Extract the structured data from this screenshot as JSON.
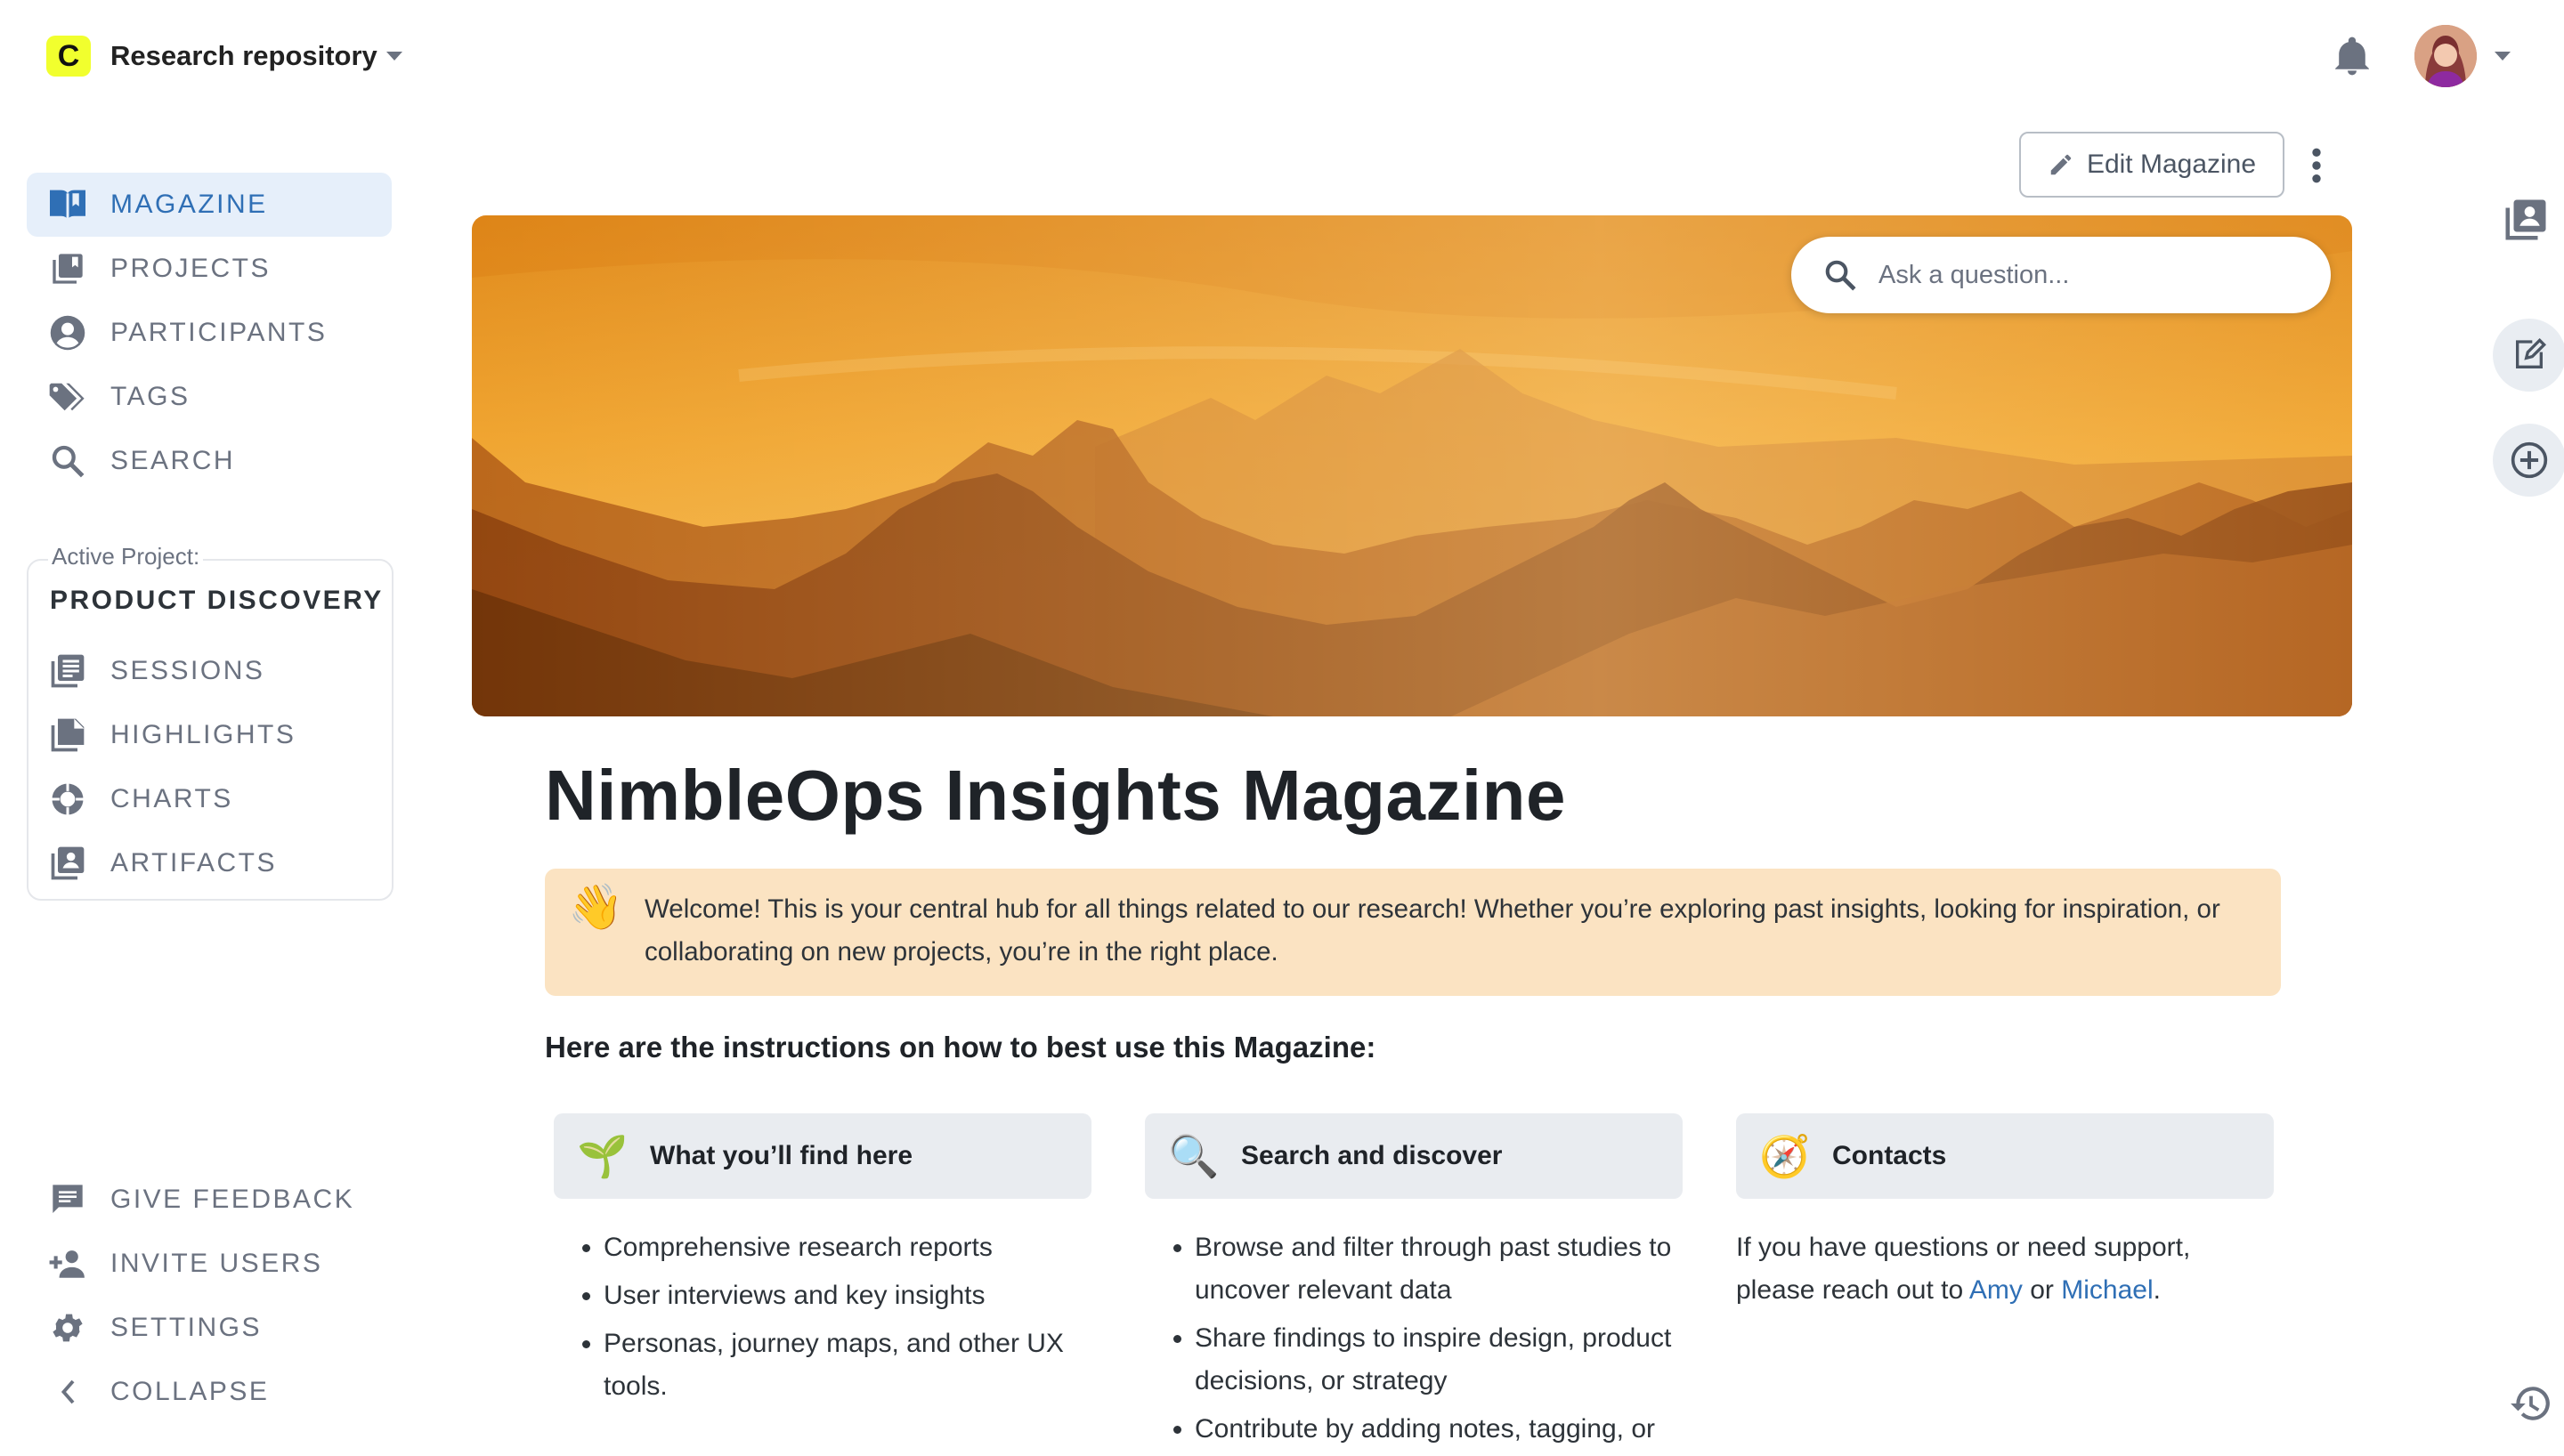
{
  "header": {
    "logo_letter": "C",
    "workspace_name": "Research repository"
  },
  "sidebar": {
    "items": [
      {
        "label": "MAGAZINE",
        "icon": "book-open-icon",
        "active": true
      },
      {
        "label": "PROJECTS",
        "icon": "projects-icon"
      },
      {
        "label": "PARTICIPANTS",
        "icon": "participant-icon"
      },
      {
        "label": "TAGS",
        "icon": "tag-icon"
      },
      {
        "label": "SEARCH",
        "icon": "search-icon"
      }
    ],
    "active_project_caption": "Active Project:",
    "active_project_name": "PRODUCT DISCOVERY",
    "project_items": [
      {
        "label": "SESSIONS",
        "icon": "sessions-icon"
      },
      {
        "label": "HIGHLIGHTS",
        "icon": "highlights-icon"
      },
      {
        "label": "CHARTS",
        "icon": "chart-icon"
      },
      {
        "label": "ARTIFACTS",
        "icon": "artifact-icon"
      }
    ],
    "bottom_items": [
      {
        "label": "GIVE FEEDBACK",
        "icon": "feedback-icon"
      },
      {
        "label": "INVITE USERS",
        "icon": "invite-user-icon"
      },
      {
        "label": "SETTINGS",
        "icon": "gear-icon"
      },
      {
        "label": "COLLAPSE",
        "icon": "chevron-left-icon"
      }
    ]
  },
  "toolbar": {
    "edit_label": "Edit Magazine"
  },
  "search": {
    "placeholder": "Ask a question..."
  },
  "main": {
    "title": "NimbleOps Insights Magazine",
    "callout": {
      "emoji": "👋",
      "text": "Welcome! This is your central hub for all things related to our research! Whether you’re exploring past insights, looking for inspiration, or collaborating on new projects, you’re in the right place."
    },
    "instructions_heading": "Here are the instructions on how to best use this Magazine:",
    "cards": [
      {
        "emoji": "🌱",
        "heading": "What you’ll find here",
        "bullets": [
          "Comprehensive research reports",
          "User interviews and key insights",
          "Personas, journey maps, and other UX tools."
        ]
      },
      {
        "emoji": "🔍",
        "heading": "Search and discover",
        "bullets": [
          "Browse and filter through past studies to uncover relevant data",
          "Share findings to inspire design, product decisions, or strategy",
          "Contribute by adding notes, tagging, or"
        ]
      },
      {
        "emoji": "🧭",
        "heading": "Contacts",
        "text_before": "If you have questions or need support, please reach out to",
        "link1": "Amy",
        "connector": "or",
        "link2": "Michael",
        "text_after": "."
      }
    ]
  },
  "colors": {
    "accent": "#2f6fb5",
    "active_nav_bg": "#e6effa",
    "callout_bg": "#fbe3c2",
    "logo_bg": "#f1ff2e"
  }
}
